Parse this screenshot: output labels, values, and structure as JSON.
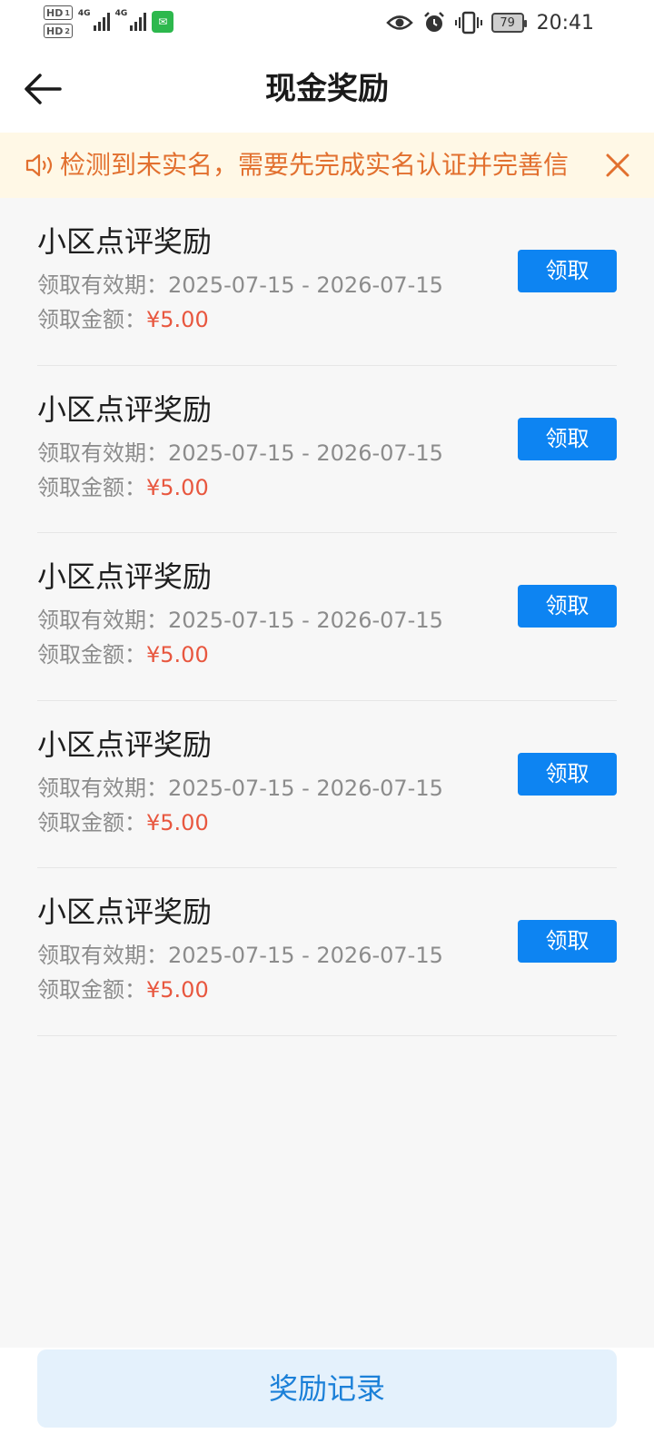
{
  "status_bar": {
    "hd_badge_1": "HD",
    "hd_badge_1_sub": "1",
    "hd_badge_2": "HD",
    "hd_badge_2_sub": "2",
    "network_1": "4G",
    "network_2": "4G",
    "battery": "79",
    "time": "20:41"
  },
  "header": {
    "title": "现金奖励"
  },
  "notice": {
    "text": "检测到未实名，需要先完成实名认证并完善信"
  },
  "rewards": [
    {
      "title": "小区点评奖励",
      "period_label": "领取有效期：",
      "period": "2025-07-15 - 2026-07-15",
      "amount_label": "领取金额：",
      "amount": "¥5.00",
      "button": "领取"
    },
    {
      "title": "小区点评奖励",
      "period_label": "领取有效期：",
      "period": "2025-07-15 - 2026-07-15",
      "amount_label": "领取金额：",
      "amount": "¥5.00",
      "button": "领取"
    },
    {
      "title": "小区点评奖励",
      "period_label": "领取有效期：",
      "period": "2025-07-15 - 2026-07-15",
      "amount_label": "领取金额：",
      "amount": "¥5.00",
      "button": "领取"
    },
    {
      "title": "小区点评奖励",
      "period_label": "领取有效期：",
      "period": "2025-07-15 - 2026-07-15",
      "amount_label": "领取金额：",
      "amount": "¥5.00",
      "button": "领取"
    },
    {
      "title": "小区点评奖励",
      "period_label": "领取有效期：",
      "period": "2025-07-15 - 2026-07-15",
      "amount_label": "领取金额：",
      "amount": "¥5.00",
      "button": "领取"
    }
  ],
  "footer": {
    "records_button": "奖励记录"
  },
  "colors": {
    "primary_blue": "#0d84f2",
    "notice_orange": "#e2702f",
    "amount_red": "#e8573f",
    "notice_bg": "#fff8e6"
  }
}
